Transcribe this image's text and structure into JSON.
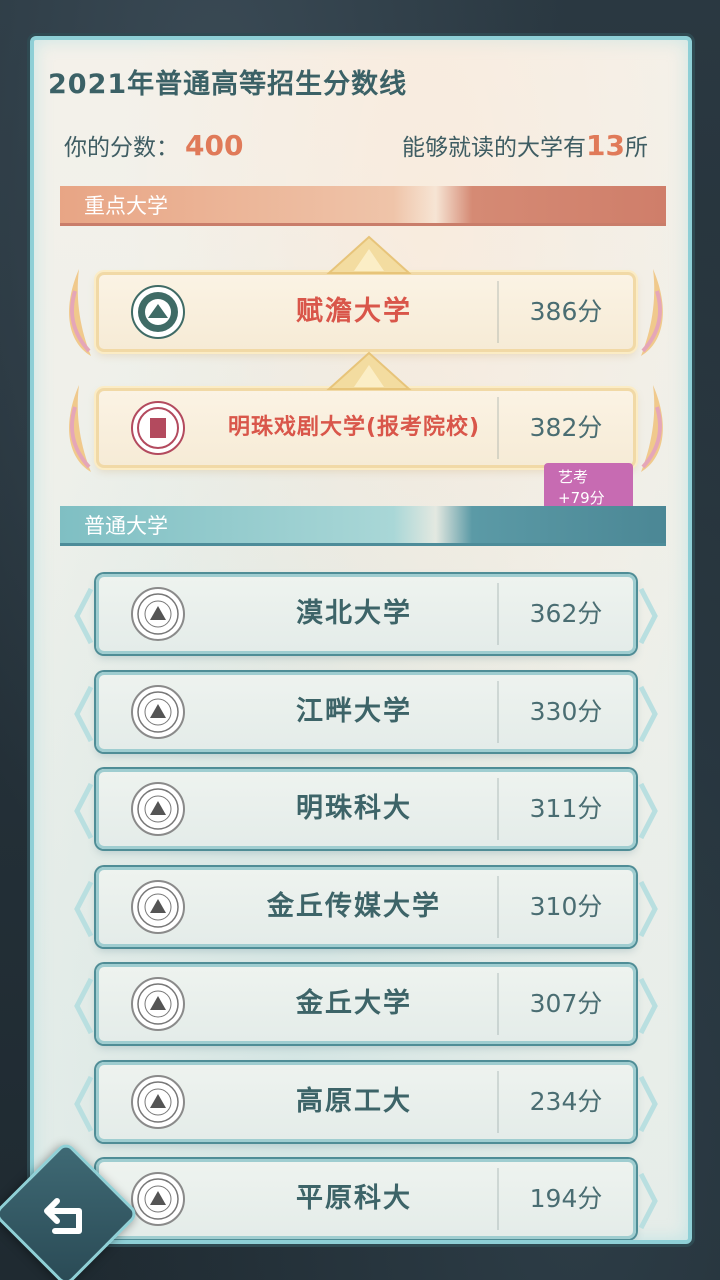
{
  "header": {
    "title": "2021年普通高等招生分数线",
    "score_label": "你的分数：",
    "score_value": "400",
    "available_prefix": "能够就读的大学有",
    "available_count": "13",
    "available_suffix": "所"
  },
  "sections": {
    "key_label": "重点大学",
    "normal_label": "普通大学"
  },
  "key_universities": [
    {
      "name": "赋澹大学",
      "score": "386分",
      "logo_icon": "university-seal-icon"
    },
    {
      "name": "明珠戏剧大学(报考院校)",
      "score": "382分",
      "badge": "艺考+79分",
      "logo_icon": "drama-seal-icon"
    }
  ],
  "normal_universities": [
    {
      "name": "漠北大学",
      "score": "362分",
      "logo_icon": "seal-icon"
    },
    {
      "name": "江畔大学",
      "score": "330分",
      "logo_icon": "seal-icon"
    },
    {
      "name": "明珠科大",
      "score": "311分",
      "logo_icon": "seal-icon"
    },
    {
      "name": "金丘传媒大学",
      "score": "310分",
      "logo_icon": "seal-icon"
    },
    {
      "name": "金丘大学",
      "score": "307分",
      "logo_icon": "seal-icon"
    },
    {
      "name": "高原工大",
      "score": "234分",
      "logo_icon": "seal-icon"
    },
    {
      "name": "平原科大",
      "score": "194分",
      "logo_icon": "seal-icon"
    }
  ],
  "colors": {
    "accent_score": "#e07a59",
    "key_name": "#d9564a",
    "normal_name": "#3d6468",
    "badge": "#c76bb2"
  },
  "back_button_icon": "back-arrow-icon"
}
